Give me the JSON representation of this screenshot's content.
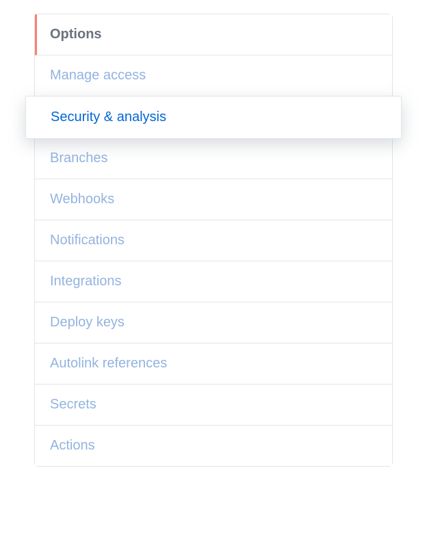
{
  "sidebar": {
    "header": "Options",
    "items": [
      {
        "label": "Manage access"
      },
      {
        "label": "Security & analysis"
      },
      {
        "label": "Branches"
      },
      {
        "label": "Webhooks"
      },
      {
        "label": "Notifications"
      },
      {
        "label": "Integrations"
      },
      {
        "label": "Deploy keys"
      },
      {
        "label": "Autolink references"
      },
      {
        "label": "Secrets"
      },
      {
        "label": "Actions"
      }
    ]
  }
}
